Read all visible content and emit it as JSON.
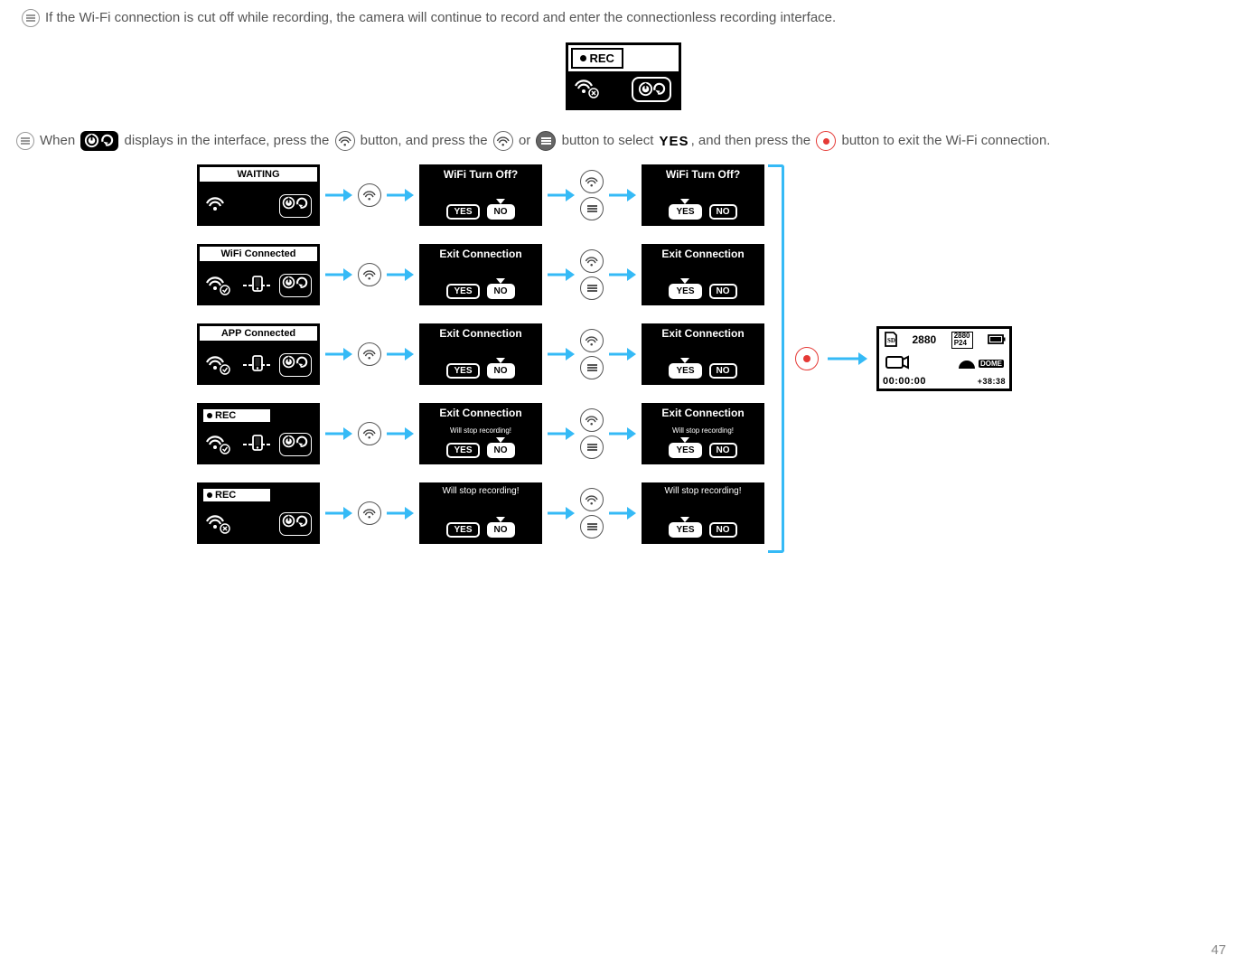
{
  "notes": {
    "note1": "If the Wi-Fi connection is cut off while recording, the camera will continue to record and enter the connectionless recording interface.",
    "note2_p1": "When ",
    "note2_p2": " displays in the interface, press the ",
    "note2_p3": " button, and press the ",
    "note2_p4": " or ",
    "note2_p5": " button to select ",
    "note2_yes": "YES",
    "note2_p6": ", and then press the ",
    "note2_p7": " button to exit the Wi-Fi connection."
  },
  "rec_chip": "REC",
  "flow": {
    "rows": [
      {
        "left": {
          "type": "status",
          "title": "WAITING",
          "wifi": "on",
          "phone": false,
          "back": true
        },
        "mid": {
          "title": "WiFi Turn Off?",
          "sub": "",
          "sel": "no"
        },
        "right": {
          "title": "WiFi Turn Off?",
          "sub": "",
          "sel": "yes"
        }
      },
      {
        "left": {
          "type": "status",
          "title": "WiFi Connected",
          "wifi": "ok",
          "phone": true,
          "back": true
        },
        "mid": {
          "title": "Exit Connection",
          "sub": "",
          "sel": "no"
        },
        "right": {
          "title": "Exit Connection",
          "sub": "",
          "sel": "yes"
        }
      },
      {
        "left": {
          "type": "status",
          "title": "APP Connected",
          "wifi": "ok",
          "phone": true,
          "back": true
        },
        "mid": {
          "title": "Exit Connection",
          "sub": "",
          "sel": "no"
        },
        "right": {
          "title": "Exit Connection",
          "sub": "",
          "sel": "yes"
        }
      },
      {
        "left": {
          "type": "rec",
          "title": "REC",
          "wifi": "ok",
          "phone": true,
          "back": true
        },
        "mid": {
          "title": "Exit Connection",
          "sub": "Will stop recording!",
          "sel": "no"
        },
        "right": {
          "title": "Exit Connection",
          "sub": "Will stop recording!",
          "sel": "yes"
        }
      },
      {
        "left": {
          "type": "rec",
          "title": "REC",
          "wifi": "off",
          "phone": false,
          "back": true
        },
        "mid": {
          "title": "Will stop recording!",
          "sub": "",
          "sel": "no"
        },
        "right": {
          "title": "Will stop recording!",
          "sub": "",
          "sel": "yes"
        }
      }
    ],
    "yes": "YES",
    "no": "NO"
  },
  "result": {
    "res": "2880",
    "fmt": "P24",
    "card": "SD",
    "mode": "DOME",
    "time": "00:00:00",
    "clock": "+38:38"
  },
  "page": "47"
}
